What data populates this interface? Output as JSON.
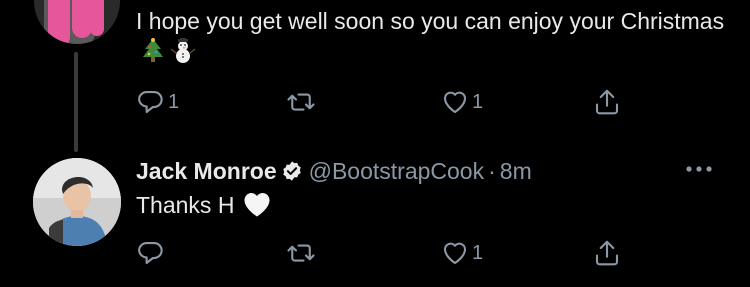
{
  "tweet1": {
    "text": "I hope you get well soon so you can enjoy your Christmas",
    "reply_count": "1",
    "retweet_count": "",
    "like_count": "1"
  },
  "tweet2": {
    "name": "Jack Monroe",
    "handle": "@BootstrapCook",
    "separator": "·",
    "time": "8m",
    "text": "Thanks H",
    "reply_count": "",
    "retweet_count": "",
    "like_count": "1"
  },
  "icons": {
    "reply": "reply-icon",
    "retweet": "retweet-icon",
    "like": "heart-icon",
    "share": "share-icon",
    "more": "more-icon",
    "verified": "verified-badge-icon"
  },
  "colors": {
    "background": "#000000",
    "text": "#e7e9ea",
    "muted": "#8b98a5"
  }
}
